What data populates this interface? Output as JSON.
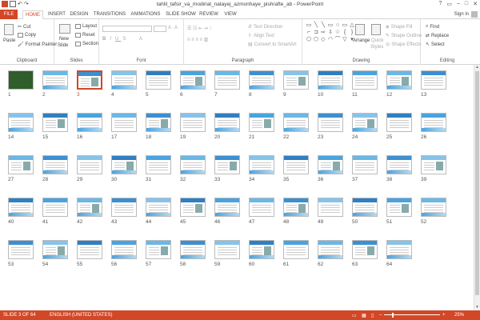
{
  "window": {
    "title": "tahlil_tafsir_va_modiriat_natayej_azmonhaye_pishrafte_ab - PowerPoint",
    "controls": [
      "?",
      "▭",
      "–",
      "□",
      "✕"
    ]
  },
  "tabs": [
    "FILE",
    "HOME",
    "INSERT",
    "DESIGN",
    "TRANSITIONS",
    "ANIMATIONS",
    "SLIDE SHOW",
    "REVIEW",
    "VIEW"
  ],
  "active_tab": "HOME",
  "signin": "Sign in",
  "ribbon": {
    "clipboard": {
      "label": "Clipboard",
      "paste": "Paste",
      "cut": "Cut",
      "copy": "Copy",
      "format_painter": "Format Painter"
    },
    "slides": {
      "label": "Slides",
      "new_slide": "New",
      "new_slide2": "Slide",
      "layout": "Layout",
      "reset": "Reset",
      "section": "Section"
    },
    "font": {
      "label": "Font"
    },
    "paragraph": {
      "label": "Paragraph",
      "text_direction": "Text Direction",
      "align_text": "Align Text",
      "convert": "Convert to SmartArt"
    },
    "drawing": {
      "label": "Drawing",
      "arrange": "Arrange",
      "quick_styles": "Quick",
      "quick_styles2": "Styles",
      "shape_fill": "Shape Fill",
      "shape_outline": "Shape Outline",
      "shape_effects": "Shape Effects"
    },
    "editing": {
      "label": "Editing",
      "find": "Find",
      "replace": "Replace",
      "select": "Select"
    }
  },
  "slides": {
    "count": 64,
    "selected": 3
  },
  "status": {
    "slide_info": "SLIDE 3 OF 64",
    "language": "ENGLISH (UNITED STATES)",
    "zoom": "25%"
  },
  "colors": {
    "accent": "#d24726"
  }
}
